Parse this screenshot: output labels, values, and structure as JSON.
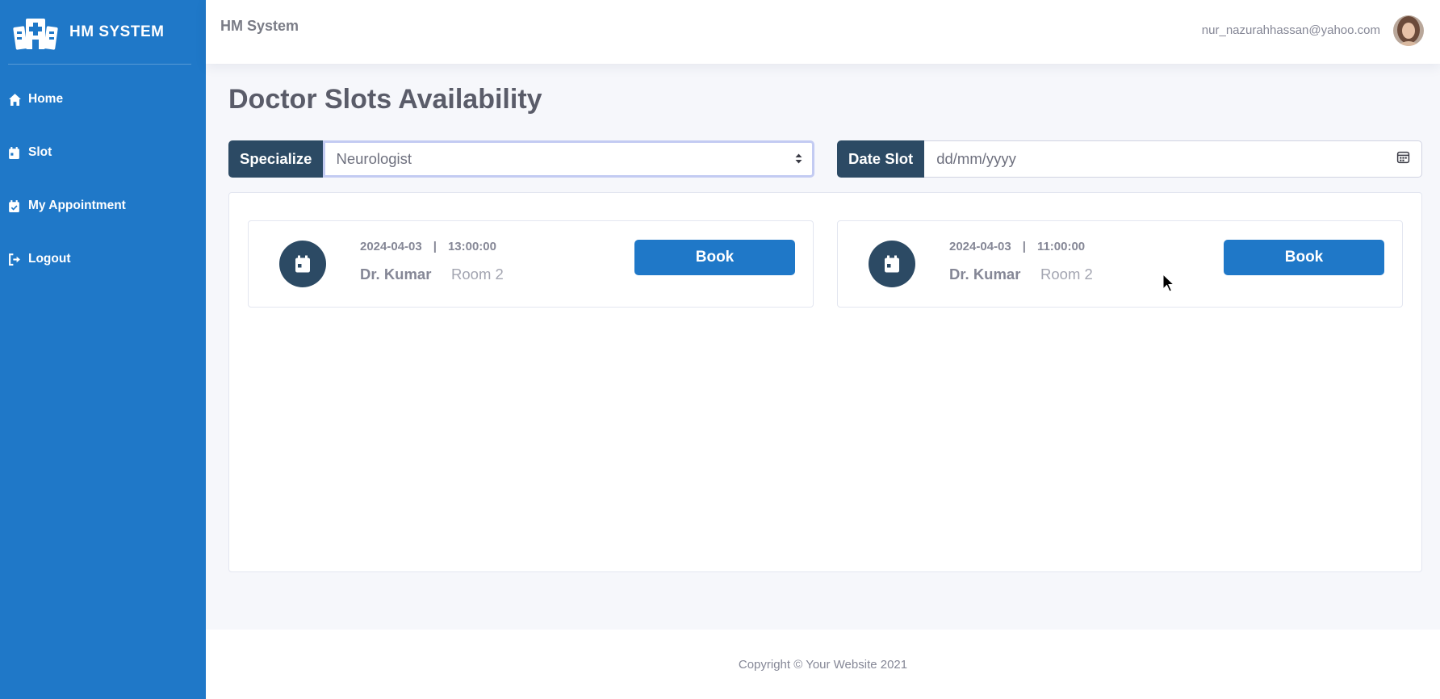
{
  "sidebar": {
    "brand": "HM SYSTEM",
    "items": [
      {
        "label": "Home",
        "icon": "home-icon"
      },
      {
        "label": "Slot",
        "icon": "calendar-icon"
      },
      {
        "label": "My Appointment",
        "icon": "calendar-check-icon"
      },
      {
        "label": "Logout",
        "icon": "logout-icon"
      }
    ]
  },
  "topbar": {
    "title": "HM System",
    "user_email": "nur_nazurahhassan@yahoo.com"
  },
  "main": {
    "title": "Doctor Slots Availability",
    "specialize_label": "Specialize",
    "specialize_value": "Neurologist",
    "date_label": "Date Slot",
    "date_placeholder": "dd/mm/yyyy",
    "slots": [
      {
        "date": "2024-04-03",
        "separator": "|",
        "time": "13:00:00",
        "doctor": "Dr. Kumar",
        "room": "Room 2",
        "button": "Book"
      },
      {
        "date": "2024-04-03",
        "separator": "|",
        "time": "11:00:00",
        "doctor": "Dr. Kumar",
        "room": "Room 2",
        "button": "Book"
      }
    ]
  },
  "footer": {
    "copyright": "Copyright © Your Website 2021"
  },
  "colors": {
    "primary": "#1f78c8",
    "dark": "#2c4a64",
    "background": "#f6f7fb",
    "select_focus": "#c3cbf2"
  }
}
